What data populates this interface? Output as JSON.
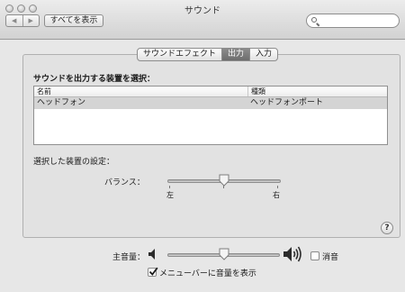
{
  "window": {
    "title": "サウンド"
  },
  "toolbar": {
    "back_icon": "chevron-left-icon",
    "forward_icon": "chevron-right-icon",
    "show_all_label": "すべてを表示",
    "search_placeholder": "",
    "search_icon": "magnifier-icon"
  },
  "tabs": [
    {
      "label": "サウンドエフェクト",
      "selected": false
    },
    {
      "label": "出力",
      "selected": true
    },
    {
      "label": "入力",
      "selected": false
    }
  ],
  "output": {
    "select_device_title": "サウンドを出力する装置を選択：",
    "columns": [
      "名前",
      "種類"
    ],
    "devices": [
      {
        "name": "ヘッドフォン",
        "type": "ヘッドフォンポート",
        "selected": true
      }
    ],
    "selected_device_settings_title": "選択した装置の設定：",
    "balance": {
      "label": "バランス：",
      "left_label": "左",
      "right_label": "右",
      "value": 0.5
    }
  },
  "help_label": "?",
  "volume": {
    "label": "主音量：",
    "min_icon": "speaker-low-icon",
    "max_icon": "speaker-high-icon",
    "value": 0.5,
    "mute_label": "消音",
    "mute_checked": false,
    "show_in_menubar_label": "メニューバーに音量を表示",
    "show_in_menubar_checked": true
  }
}
